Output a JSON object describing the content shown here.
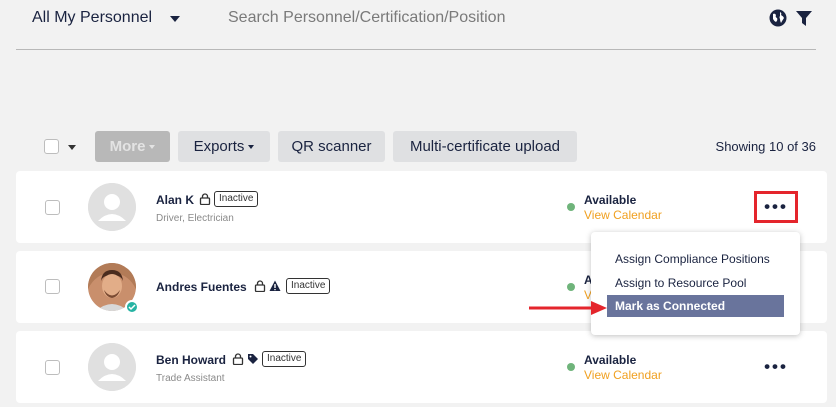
{
  "header": {
    "scope_label": "All My Personnel",
    "search_placeholder": "Search Personnel/Certification/Position"
  },
  "toolbar": {
    "more_label": "More",
    "exports_label": "Exports",
    "qr_label": "QR scanner",
    "multi_upload_label": "Multi-certificate upload",
    "showing_text": "Showing 10 of 36"
  },
  "personnel": [
    {
      "name": "Alan K",
      "subtitle": "Driver, Electrician",
      "badge": "Inactive",
      "status": "Available",
      "calendar_link": "View Calendar"
    },
    {
      "name": "Andres Fuentes",
      "subtitle": "",
      "badge": "Inactive",
      "status": "A",
      "calendar_link": "V"
    },
    {
      "name": "Ben Howard",
      "subtitle": "Trade Assistant",
      "badge": "Inactive",
      "status": "Available",
      "calendar_link": "View Calendar"
    }
  ],
  "context_menu": {
    "items": [
      "Assign Compliance Positions",
      "Assign to Resource Pool",
      "Mark as Connected"
    ],
    "highlighted_index": 2
  },
  "colors": {
    "accent_orange": "#f0a020",
    "status_green": "#6fb47b",
    "highlight_red": "#e4252c",
    "menu_selected": "#69749c",
    "navy": "#1a2340"
  },
  "icons": [
    "globe-icon",
    "filter-icon",
    "lock-icon",
    "warning-icon",
    "tag-icon",
    "more-options-icon",
    "verified-icon"
  ]
}
